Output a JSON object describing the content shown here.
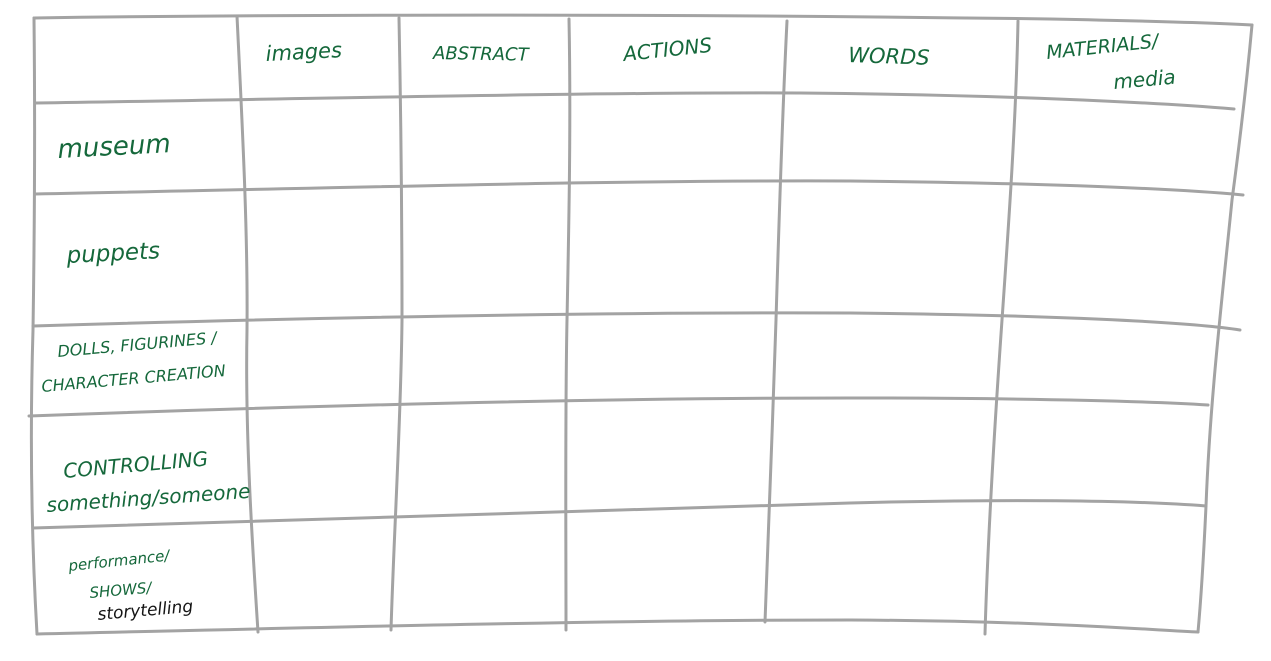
{
  "grid": {
    "line_color": "#a3a3a3",
    "ink_color": "#15683b",
    "ink_color_dark": "#141414",
    "columns": [
      {
        "lines": [
          "images"
        ]
      },
      {
        "lines": [
          "ABSTRACT"
        ]
      },
      {
        "lines": [
          "ACTIONS"
        ]
      },
      {
        "lines": [
          "WORDS"
        ]
      },
      {
        "lines": [
          "MATERIALS/",
          "media"
        ]
      }
    ],
    "rows": [
      {
        "lines": [
          "museum"
        ]
      },
      {
        "lines": [
          "puppets"
        ]
      },
      {
        "lines": [
          "DOLLS, FIGURINES /",
          "CHARACTER CREATION"
        ]
      },
      {
        "lines": [
          "CONTROLLING",
          "something/someone"
        ]
      },
      {
        "lines": [
          "performance/",
          "SHOWS/"
        ],
        "extra_dark": "storytelling"
      }
    ]
  }
}
